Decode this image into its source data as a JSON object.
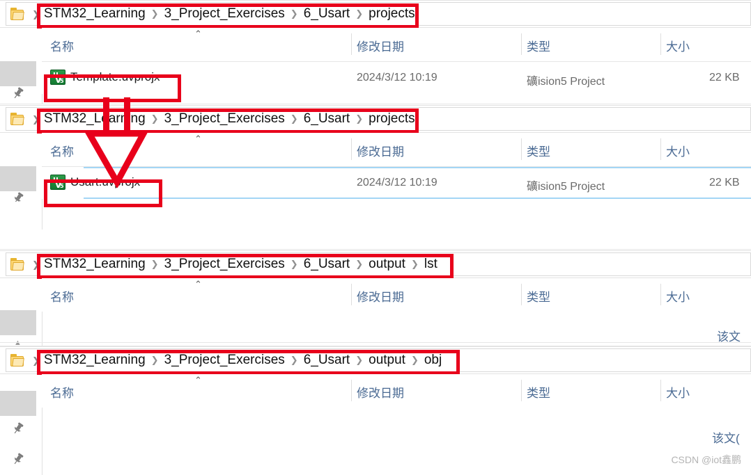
{
  "accent": {
    "annotation_red": "#e8001b",
    "header_text_blue": "#4a6a93",
    "select_line": "#a3d6f5"
  },
  "columns": {
    "name": "名称",
    "date_modified": "修改日期",
    "type": "类型",
    "size": "大小",
    "sort_caret": "⌃"
  },
  "icons": {
    "folder": "folder-icon",
    "chevron": "❯",
    "crumb_sep": "❯",
    "uvision_glyph_top": "μ",
    "uvision_glyph_mid": "V",
    "uvision_glyph_sub": "5",
    "pin": "📌",
    "up_caret": "▲"
  },
  "panes": [
    {
      "id": "pane-1",
      "breadcrumb": [
        "STM32_Learning",
        "3_Project_Exercises",
        "6_Usart",
        "projects"
      ],
      "highlighted": true,
      "rows": [
        {
          "name": "Template.uvprojx",
          "date": "2024/3/12 10:19",
          "type": "礦ision5 Project",
          "size": "22 KB",
          "selected": false,
          "boxed": true
        }
      ],
      "trailing_text": ""
    },
    {
      "id": "pane-2",
      "breadcrumb": [
        "STM32_Learning",
        "3_Project_Exercises",
        "6_Usart",
        "projects"
      ],
      "highlighted": true,
      "rows": [
        {
          "name": "Usart.uvprojx",
          "date": "2024/3/12 10:19",
          "type": "礦ision5 Project",
          "size": "22 KB",
          "selected": true,
          "boxed": true
        }
      ],
      "trailing_text": ""
    },
    {
      "id": "pane-3",
      "breadcrumb": [
        "STM32_Learning",
        "3_Project_Exercises",
        "6_Usart",
        "output",
        "lst"
      ],
      "highlighted": true,
      "rows": [],
      "trailing_text": "该文"
    },
    {
      "id": "pane-4",
      "breadcrumb": [
        "STM32_Learning",
        "3_Project_Exercises",
        "6_Usart",
        "output",
        "obj"
      ],
      "highlighted": true,
      "rows": [],
      "trailing_text": "该文("
    }
  ],
  "annotation": {
    "arrow_description": "red-arrow-template-to-usart",
    "color": "#e8001b"
  },
  "watermark": "CSDN @iot鑫鹏"
}
